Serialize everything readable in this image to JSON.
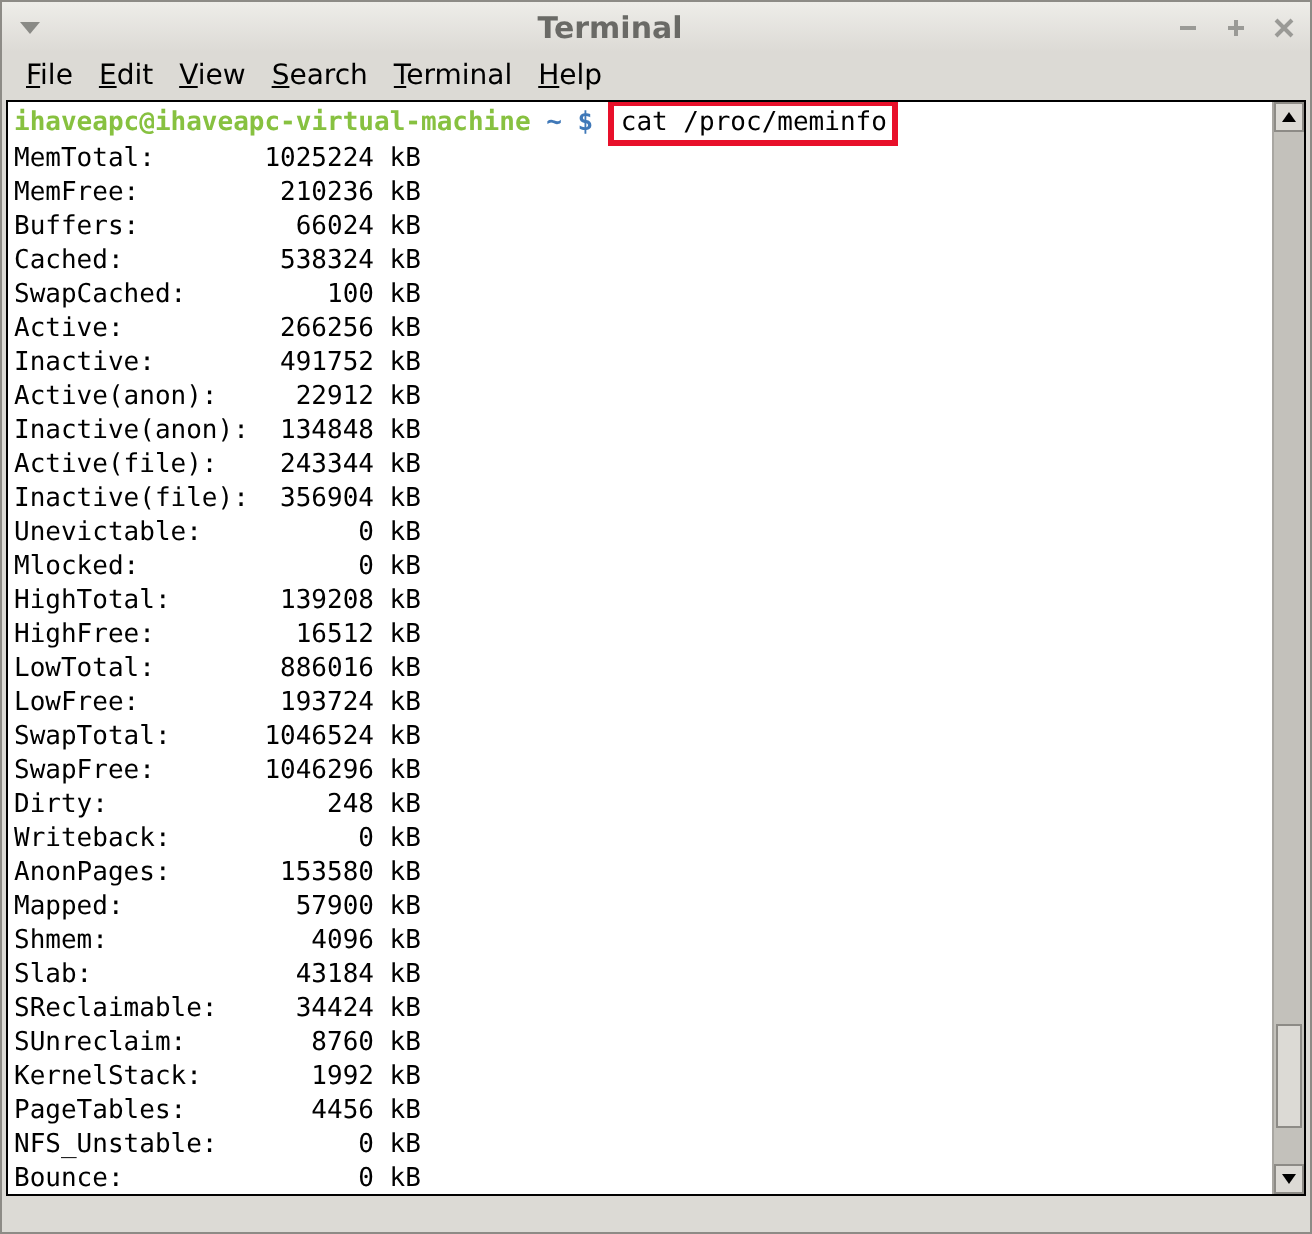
{
  "window": {
    "title": "Terminal"
  },
  "menu": [
    "File",
    "Edit",
    "View",
    "Search",
    "Terminal",
    "Help"
  ],
  "prompt": {
    "user_host": "ihaveapc@ihaveapc-virtual-machine",
    "path": "~",
    "symbol": "$",
    "command": "cat /proc/meminfo",
    "highlighted": true
  },
  "output": [
    {
      "name": "MemTotal:",
      "value": "1025224 kB"
    },
    {
      "name": "MemFree:",
      "value": "210236 kB"
    },
    {
      "name": "Buffers:",
      "value": "66024 kB"
    },
    {
      "name": "Cached:",
      "value": "538324 kB"
    },
    {
      "name": "SwapCached:",
      "value": "100 kB"
    },
    {
      "name": "Active:",
      "value": "266256 kB"
    },
    {
      "name": "Inactive:",
      "value": "491752 kB"
    },
    {
      "name": "Active(anon):",
      "value": "22912 kB"
    },
    {
      "name": "Inactive(anon):",
      "value": "134848 kB"
    },
    {
      "name": "Active(file):",
      "value": "243344 kB"
    },
    {
      "name": "Inactive(file):",
      "value": "356904 kB"
    },
    {
      "name": "Unevictable:",
      "value": "0 kB"
    },
    {
      "name": "Mlocked:",
      "value": "0 kB"
    },
    {
      "name": "HighTotal:",
      "value": "139208 kB"
    },
    {
      "name": "HighFree:",
      "value": "16512 kB"
    },
    {
      "name": "LowTotal:",
      "value": "886016 kB"
    },
    {
      "name": "LowFree:",
      "value": "193724 kB"
    },
    {
      "name": "SwapTotal:",
      "value": "1046524 kB"
    },
    {
      "name": "SwapFree:",
      "value": "1046296 kB"
    },
    {
      "name": "Dirty:",
      "value": "248 kB"
    },
    {
      "name": "Writeback:",
      "value": "0 kB"
    },
    {
      "name": "AnonPages:",
      "value": "153580 kB"
    },
    {
      "name": "Mapped:",
      "value": "57900 kB"
    },
    {
      "name": "Shmem:",
      "value": "4096 kB"
    },
    {
      "name": "Slab:",
      "value": "43184 kB"
    },
    {
      "name": "SReclaimable:",
      "value": "34424 kB"
    },
    {
      "name": "SUnreclaim:",
      "value": "8760 kB"
    },
    {
      "name": "KernelStack:",
      "value": "1992 kB"
    },
    {
      "name": "PageTables:",
      "value": "4456 kB"
    },
    {
      "name": "NFS_Unstable:",
      "value": "0 kB"
    },
    {
      "name": "Bounce:",
      "value": "0 kB"
    }
  ]
}
